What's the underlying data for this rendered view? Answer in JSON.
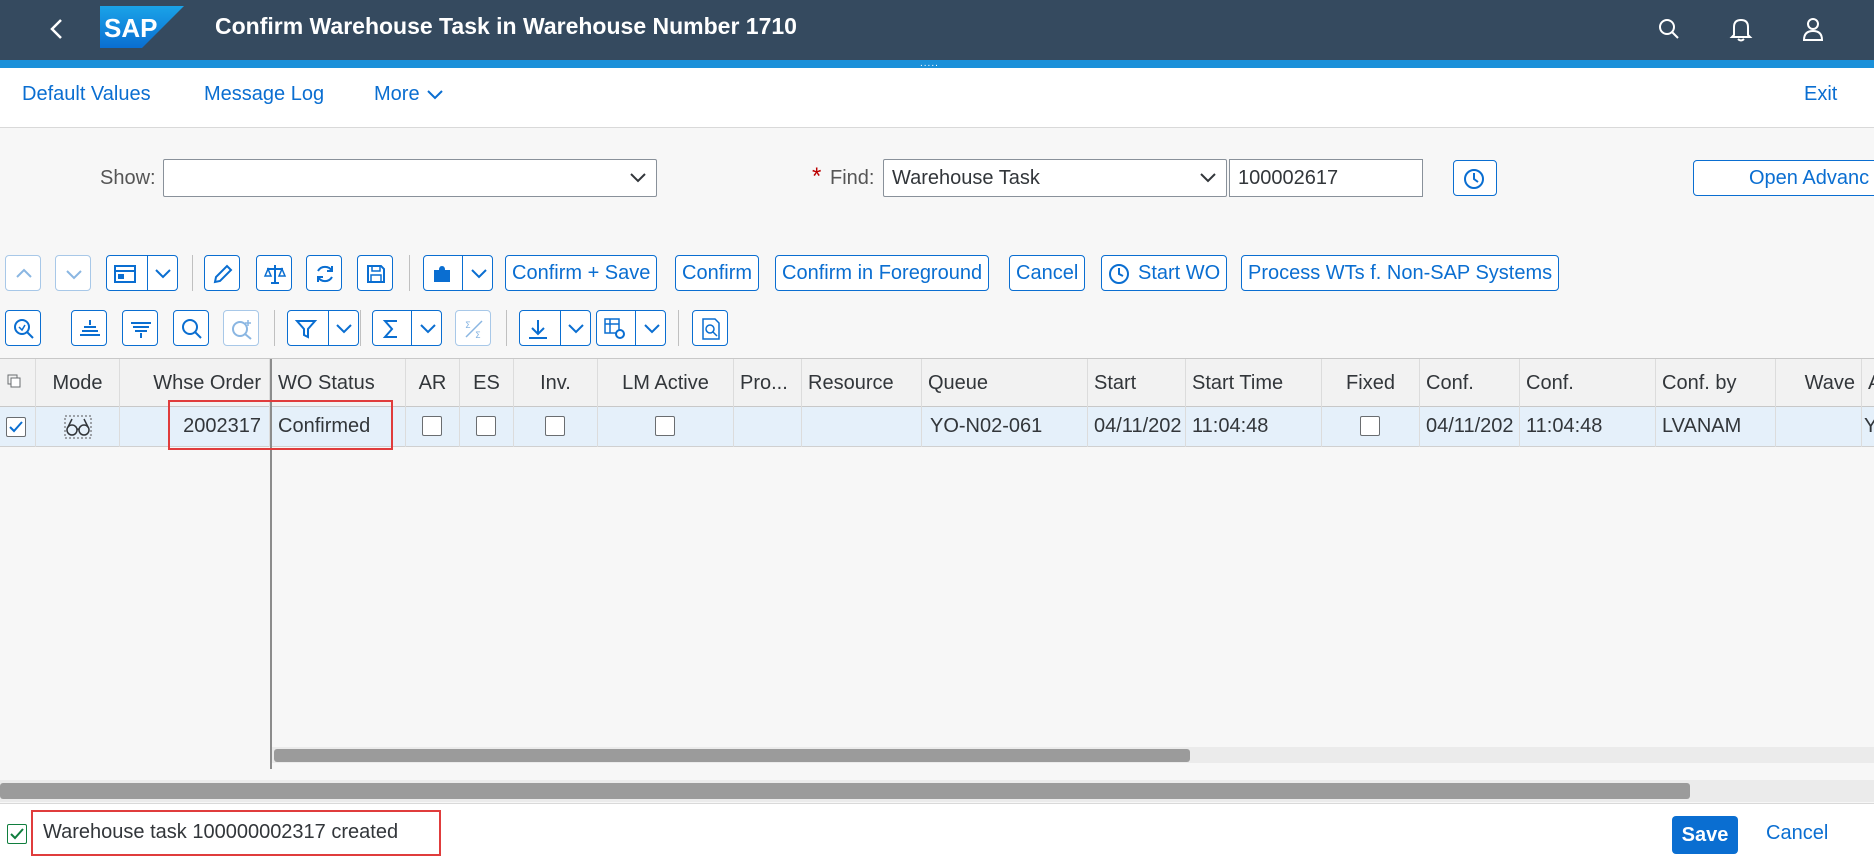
{
  "shell": {
    "title": "Confirm Warehouse Task in Warehouse Number 1710",
    "logo_text": "SAP",
    "icons": [
      "back-icon",
      "search-icon",
      "bell-icon",
      "user-icon"
    ]
  },
  "menubar": {
    "items": [
      "Default Values",
      "Message Log",
      "More"
    ],
    "exit": "Exit"
  },
  "filter": {
    "show_label": "Show:",
    "show_value": "",
    "find_required": "*",
    "find_label": "Find:",
    "find_type": "Warehouse Task",
    "find_value": "100002617",
    "open_advanced": "Open Advanc"
  },
  "toolbar1": {
    "buttons": [
      "Confirm + Save",
      "Confirm",
      "Confirm in Foreground",
      "Cancel",
      "Start WO",
      "Process WTs f. Non-SAP Systems"
    ]
  },
  "grid": {
    "columns": [
      "Mode",
      "Whse Order",
      "WO Status",
      "AR",
      "ES",
      "Inv.",
      "LM Active",
      "Pro...",
      "Resource",
      "Queue",
      "Start",
      "Start Time",
      "Fixed",
      "Conf.",
      "Conf.",
      "Conf. by",
      "Wave",
      "A"
    ],
    "row": {
      "whse_order": "2002317",
      "wo_status": "Confirmed",
      "queue": "YO-N02-061",
      "start": "04/11/202",
      "start_time": "11:04:48",
      "conf_date": "04/11/202",
      "conf_time": "11:04:48",
      "conf_by": "LVANAM",
      "last": "Y"
    }
  },
  "footer": {
    "message": "Warehouse task 100000002317 created",
    "save": "Save",
    "cancel": "Cancel"
  },
  "colors": {
    "shell": "#354a5f",
    "accent": "#0a6ed1",
    "highlight": "#e03c3c"
  }
}
